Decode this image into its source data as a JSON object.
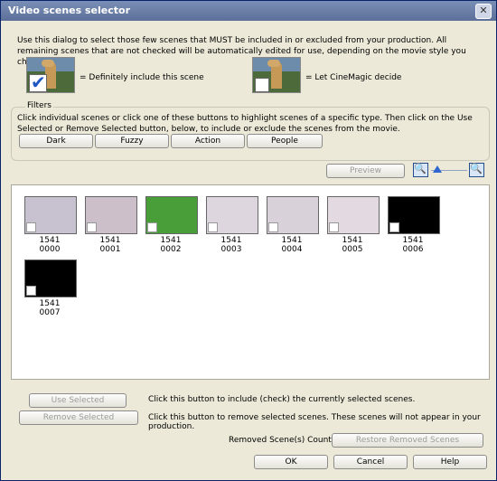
{
  "window": {
    "title": "Video scenes selector",
    "close": "✕"
  },
  "intro": "Use this dialog to select those few scenes that MUST be included in or excluded from your production. All remaining scenes that are not checked will be automatically edited for use, depending on the movie style you choose.",
  "legend": {
    "include": "= Definitely include this scene",
    "auto": "= Let CineMagic decide"
  },
  "filters": {
    "label": "Filters",
    "text": "Click individual scenes or click one of these buttons to highlight scenes of a specific type. Then click on the Use Selected or Remove Selected button, below, to include or exclude the scenes from the movie.",
    "buttons": [
      "Dark",
      "Fuzzy",
      "Action",
      "People"
    ]
  },
  "toolbar": {
    "preview": "Preview"
  },
  "scenes": [
    {
      "id": "1541",
      "num": "0000",
      "color": "#c8c1cf"
    },
    {
      "id": "1541",
      "num": "0001",
      "color": "#cdbfca"
    },
    {
      "id": "1541",
      "num": "0002",
      "color": "#4a9e39"
    },
    {
      "id": "1541",
      "num": "0003",
      "color": "#ddd6df"
    },
    {
      "id": "1541",
      "num": "0004",
      "color": "#d8d1da"
    },
    {
      "id": "1541",
      "num": "0005",
      "color": "#e3d9e1"
    },
    {
      "id": "1541",
      "num": "0006",
      "color": "#000000"
    },
    {
      "id": "1541",
      "num": "0007",
      "color": "#000000"
    }
  ],
  "actions": {
    "use_selected": "Use Selected",
    "use_text": "Click this button to include (check) the currently selected scenes.",
    "remove_selected": "Remove Selected",
    "remove_text": "Click this button to remove selected scenes. These scenes will not appear in your production.",
    "removed_count": "Removed Scene(s) Count:  0",
    "restore": "Restore Removed Scenes"
  },
  "footer": {
    "ok": "OK",
    "cancel": "Cancel",
    "help": "Help"
  }
}
